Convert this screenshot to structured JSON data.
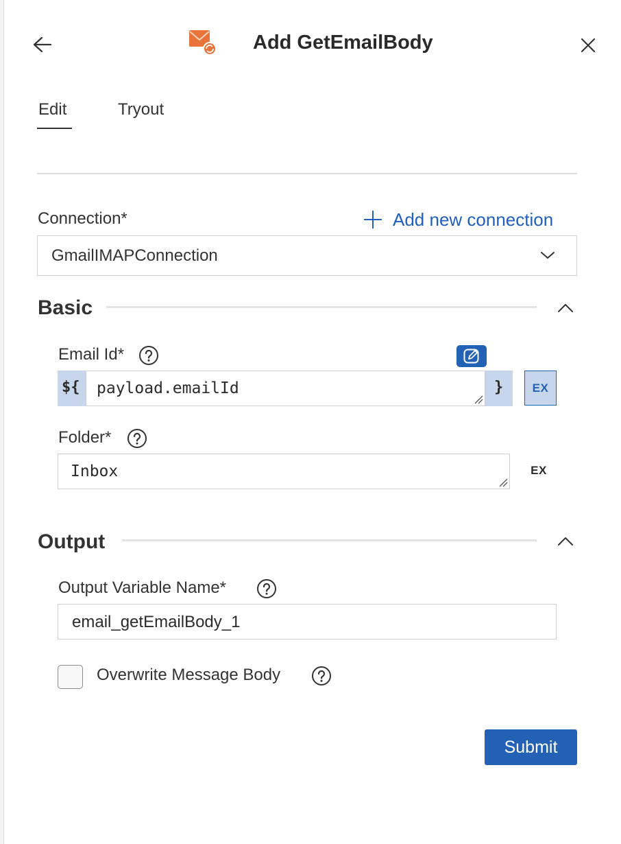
{
  "header": {
    "title": "Add GetEmailBody",
    "back_icon": "arrow-left-icon",
    "close_icon": "close-icon",
    "app_icon": "email-sync-icon"
  },
  "tabs": [
    {
      "label": "Edit",
      "active": true
    },
    {
      "label": "Tryout",
      "active": false
    }
  ],
  "connection": {
    "label": "Connection*",
    "add_label": "Add new connection",
    "selected": "GmailIMAPConnection"
  },
  "basic": {
    "title": "Basic",
    "email_id": {
      "label": "Email Id*",
      "prefix": "${",
      "value": "payload.emailId",
      "suffix": "}",
      "ex_label": "EX"
    },
    "folder": {
      "label": "Folder*",
      "value": "Inbox",
      "ex_label": "EX"
    }
  },
  "output": {
    "title": "Output",
    "variable": {
      "label": "Output Variable Name*",
      "value": "email_getEmailBody_1"
    },
    "overwrite": {
      "label": "Overwrite Message Body",
      "checked": false
    }
  },
  "submit_label": "Submit",
  "colors": {
    "primary": "#2361b4",
    "link": "#1f5fbf",
    "accent": "#e8743b",
    "expr_bg": "#c7d6ea"
  }
}
